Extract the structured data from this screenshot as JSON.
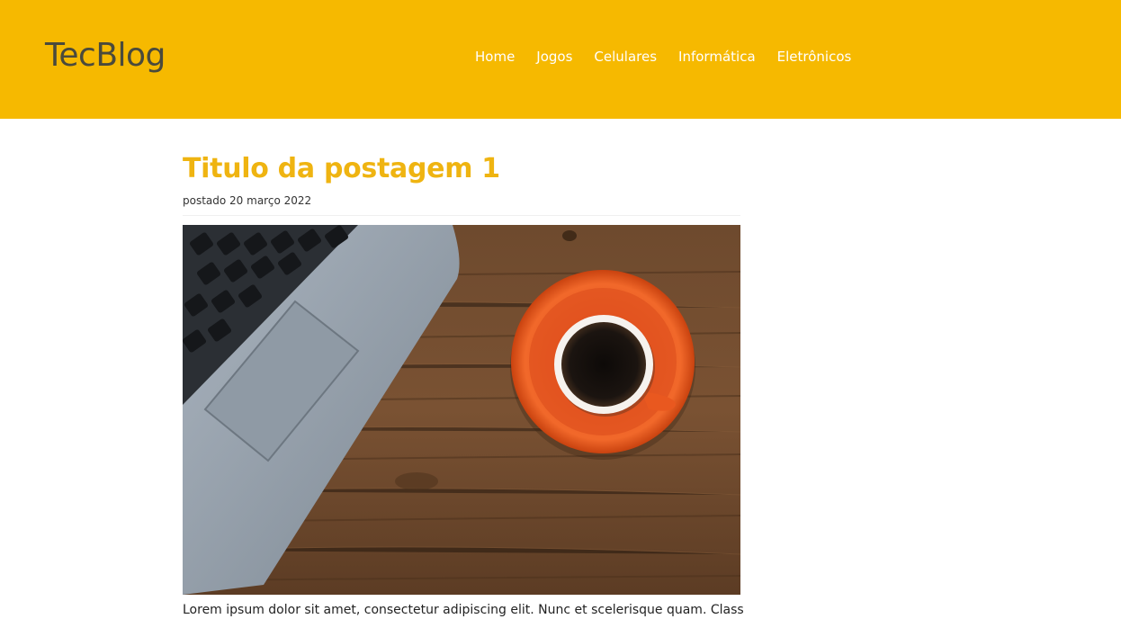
{
  "header": {
    "logo": "TecBlog",
    "nav": [
      {
        "label": "Home"
      },
      {
        "label": "Jogos"
      },
      {
        "label": "Celulares"
      },
      {
        "label": "Informática"
      },
      {
        "label": "Eletrônicos"
      }
    ],
    "background_color": "#f6b900"
  },
  "post": {
    "title": "Titulo da postagem 1",
    "date": "postado 20 março 2022",
    "image": "laptop-and-coffee-photo",
    "excerpt": "Lorem ipsum dolor sit amet, consectetur adipiscing elit. Nunc et scelerisque quam. Class",
    "title_color": "#efb411"
  }
}
